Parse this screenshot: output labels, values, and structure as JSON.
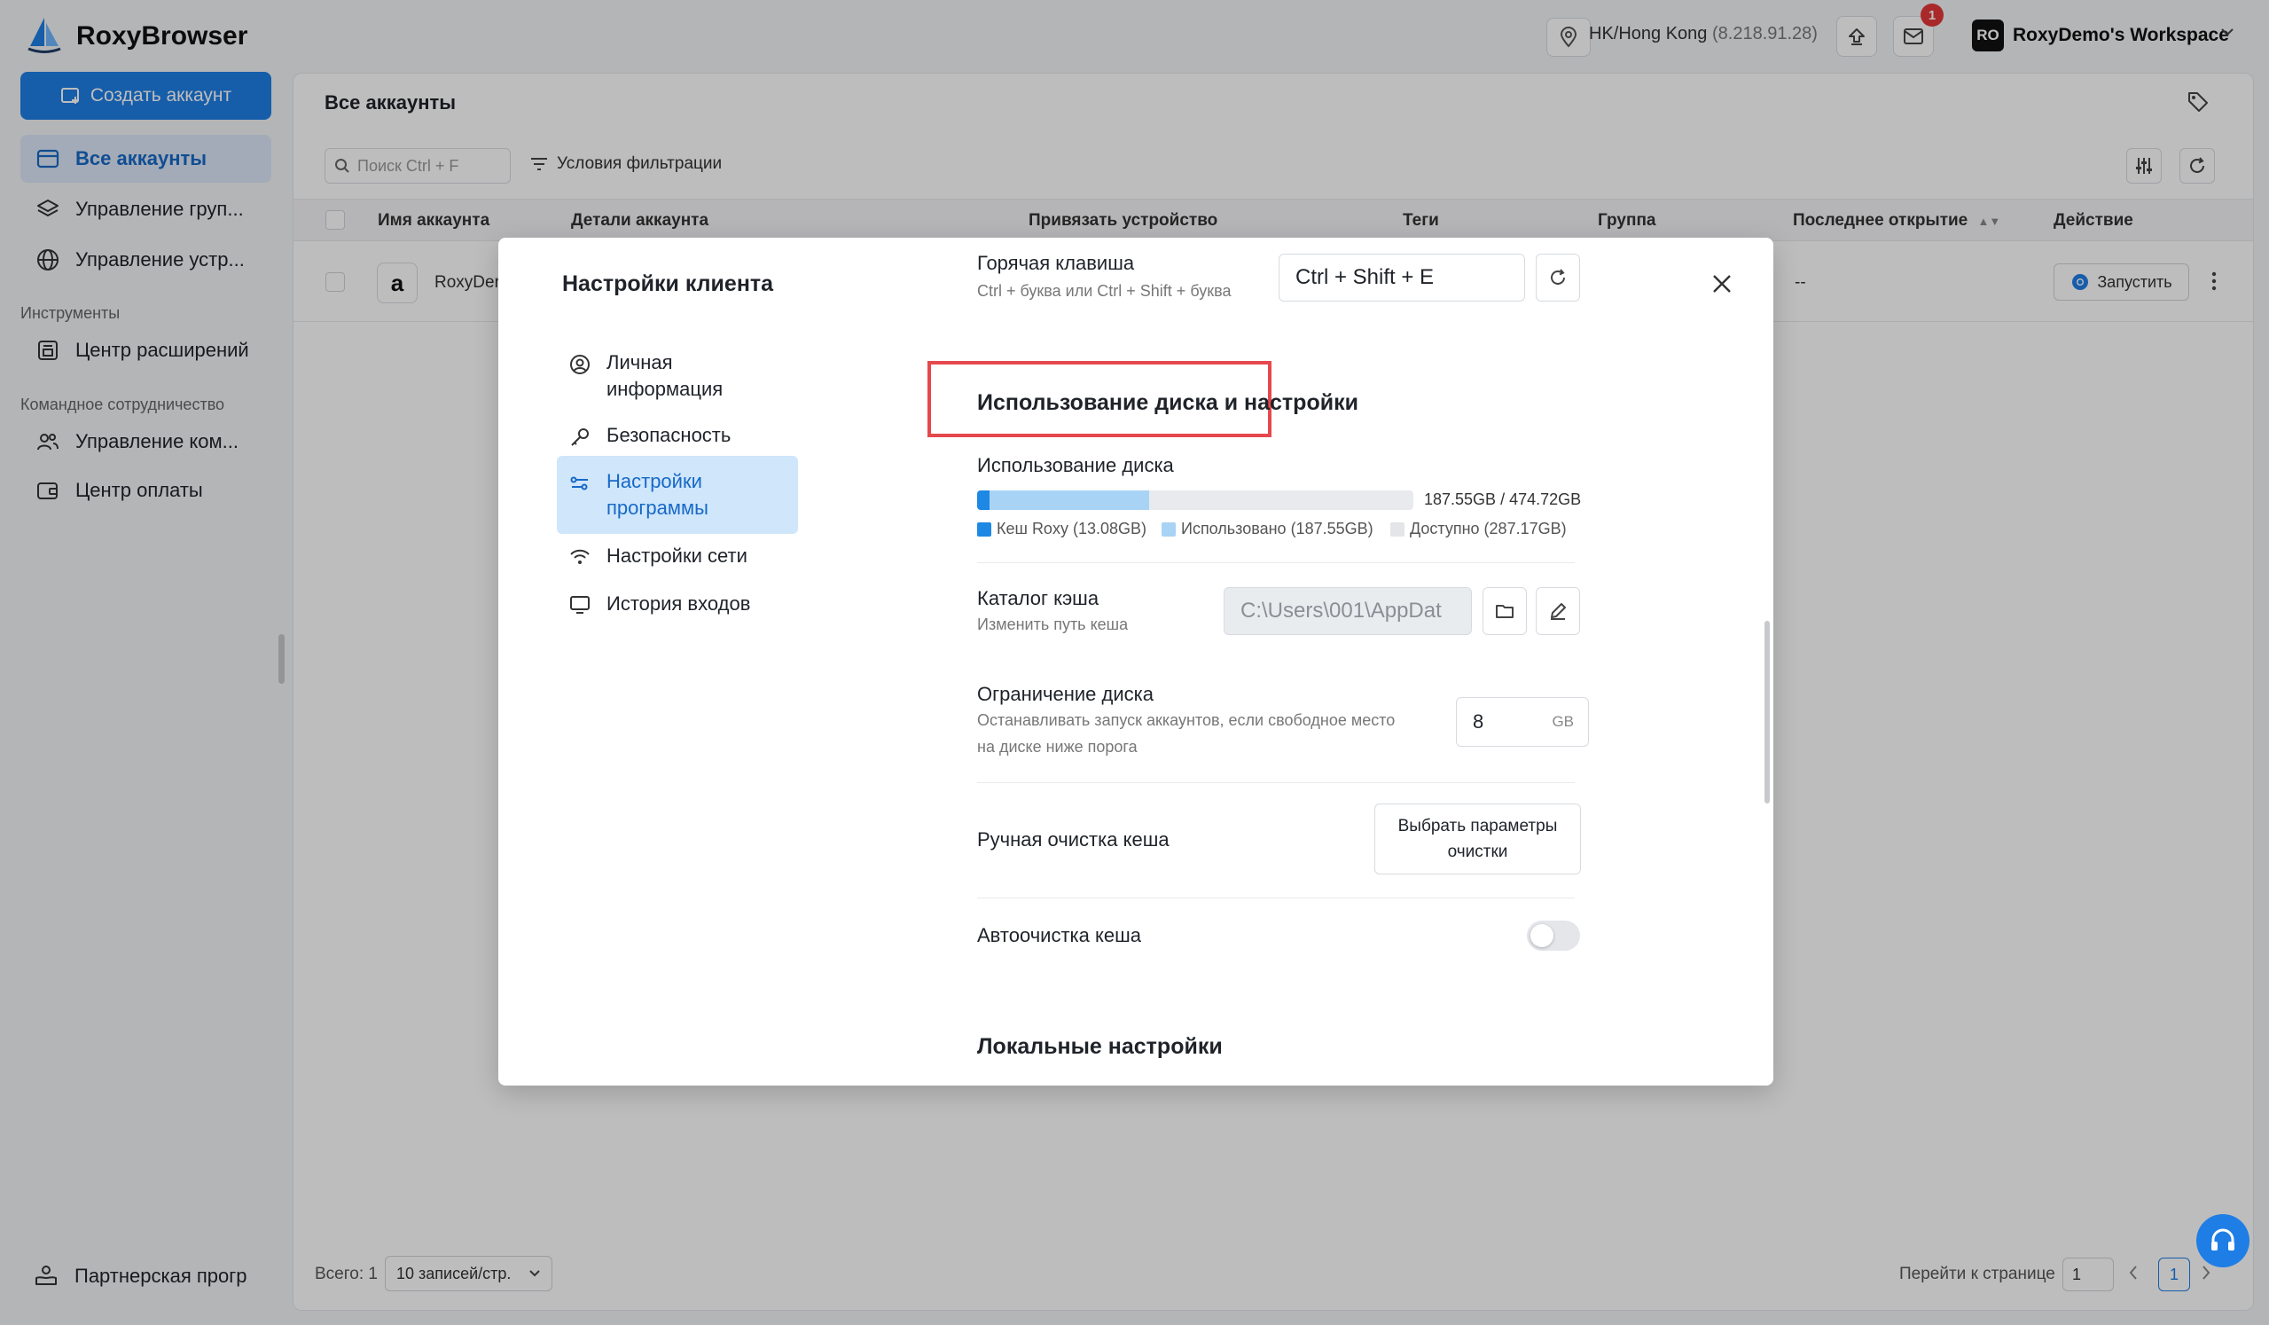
{
  "app": {
    "name": "RoxyBrowser"
  },
  "topbar": {
    "location": "HK/Hong Kong",
    "ip": "(8.218.91.28)",
    "mail_badge": "1",
    "workspace_initials": "RO",
    "workspace_name": "RoxyDemo's Workspace"
  },
  "sidebar": {
    "create_label": "Создать аккаунт",
    "items": [
      {
        "label": "Все аккаунты",
        "icon": "window-icon"
      },
      {
        "label": "Управление груп...",
        "icon": "layers-icon"
      },
      {
        "label": "Управление устр...",
        "icon": "globe-icon"
      }
    ],
    "section_tools": "Инструменты",
    "tools_items": [
      {
        "label": "Центр расширений",
        "icon": "extension-icon"
      }
    ],
    "section_team": "Командное сотрудничество",
    "team_items": [
      {
        "label": "Управление ком...",
        "icon": "users-icon"
      },
      {
        "label": "Центр оплаты",
        "icon": "wallet-icon"
      }
    ],
    "partner_label": "Партнерская прогр"
  },
  "main": {
    "title": "Все аккаунты",
    "search_placeholder": "Поиск Ctrl + F",
    "filter_label": "Условия фильтрации",
    "columns": [
      "Имя аккаунта",
      "Детали аккаунта",
      "Привязать устройство",
      "Теги",
      "Группа",
      "Последнее открытие",
      "Действие"
    ],
    "rows": [
      {
        "name": "RoxyDer",
        "last_open": "--",
        "action": "Запустить"
      }
    ],
    "footer": {
      "total": "Всего: 1",
      "per_page": "10 записей/стр.",
      "goto_label": "Перейти к странице",
      "goto_value": "1",
      "current_page": "1"
    }
  },
  "modal": {
    "title": "Настройки клиента",
    "nav": [
      {
        "label": "Личная информация",
        "icon": "user-circle-icon"
      },
      {
        "label": "Безопасность",
        "icon": "key-icon"
      },
      {
        "label": "Настройки программы",
        "icon": "settings-sliders-icon"
      },
      {
        "label": "Настройки сети",
        "icon": "wifi-icon"
      },
      {
        "label": "История входов",
        "icon": "monitor-icon"
      }
    ],
    "hotkey": {
      "label": "Горячая клавиша",
      "hint": "Ctrl + буква или Ctrl + Shift + буква",
      "value": "Ctrl + Shift + E"
    },
    "disk_section_title": "Использование диска и настройки",
    "disk_usage": {
      "label": "Использование диска",
      "summary": "187.55GB / 474.72GB",
      "cache_gb": 13.08,
      "used_gb": 187.55,
      "total_gb": 474.72,
      "legend_cache": "Кеш Roxy (13.08GB)",
      "legend_used": "Использовано (187.55GB)",
      "legend_free": "Доступно (287.17GB)",
      "colors": {
        "cache": "#1e88e5",
        "used": "#a9d3f5",
        "free": "#e8eaed"
      }
    },
    "cache_dir": {
      "label": "Каталог кэша",
      "hint": "Изменить путь кеша",
      "value": "C:\\Users\\001\\AppDat"
    },
    "disk_limit": {
      "label": "Ограничение диска",
      "hint_line1": "Останавливать запуск аккаунтов, если свободное место",
      "hint_line2": "на диске ниже порога",
      "value": "8",
      "unit": "GB"
    },
    "manual_clean": {
      "label": "Ручная очистка кеша",
      "button_line1": "Выбрать параметры",
      "button_line2": "очистки"
    },
    "auto_clean": {
      "label": "Автоочистка кеша",
      "enabled": false
    },
    "local_settings_title": "Локальные настройки"
  }
}
